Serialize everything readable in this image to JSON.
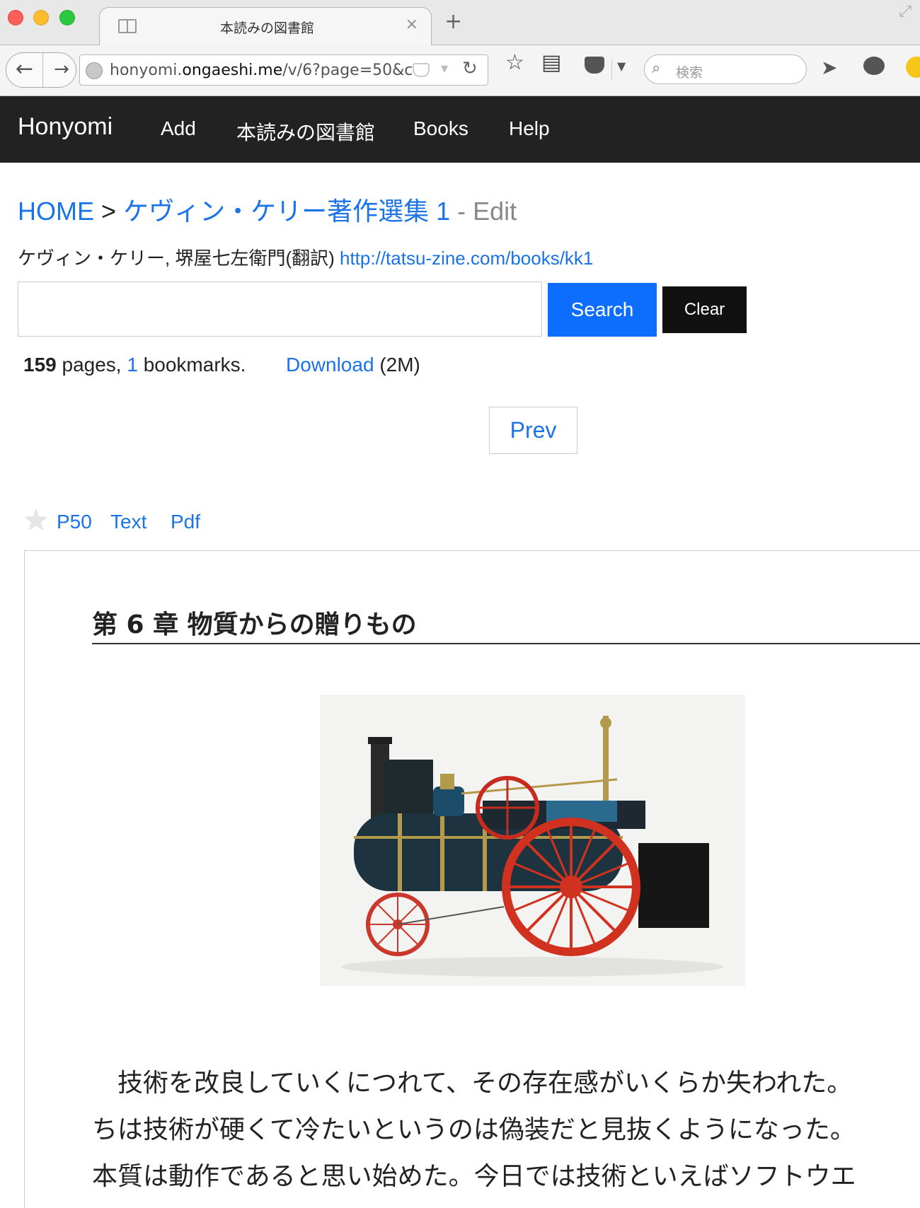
{
  "browser": {
    "tab_title": "本読みの図書館",
    "url_prefix": "honyomi.",
    "url_host": "ongaeshi.me",
    "url_path": "/v/6?page=50&c",
    "search_placeholder": "検索",
    "close_glyph": "×",
    "new_tab_glyph": "+"
  },
  "site": {
    "brand": "Honyomi",
    "nav": [
      "Add",
      "本読みの図書館",
      "Books",
      "Help"
    ]
  },
  "breadcrumb": {
    "home": "HOME",
    "separator": ">",
    "book_title": "ケヴィン・ケリー著作選集 1",
    "suffix": "- Edit"
  },
  "book": {
    "authors": "ケヴィン・ケリー, 堺屋七左衛門(翻訳)",
    "url": "http://tatsu-zine.com/books/kk1",
    "pages_count": "159",
    "pages_label": "pages,",
    "bookmarks_count": "1",
    "bookmarks_label": "bookmarks.",
    "download_label": "Download",
    "download_size": "(2M)"
  },
  "search": {
    "value": "",
    "search_button": "Search",
    "clear_button": "Clear"
  },
  "pager": {
    "prev": "Prev"
  },
  "page": {
    "number_link": "P50",
    "text_link": "Text",
    "pdf_link": "Pdf",
    "bookmarked": false,
    "chapter_title": "第 6 章 物質からの贈りもの",
    "paragraph_lines": [
      "　技術を改良していくにつれて、その存在感がいくらか失われた。",
      "ちは技術が硬くて冷たいというのは偽装だと見抜くようになった。",
      "本質は動作であると思い始めた。今日では技術といえばソフトウエ"
    ]
  },
  "colors": {
    "link": "#1a73e8",
    "header_bg": "#222222",
    "search_button": "#0d6efd",
    "clear_button": "#111111"
  }
}
